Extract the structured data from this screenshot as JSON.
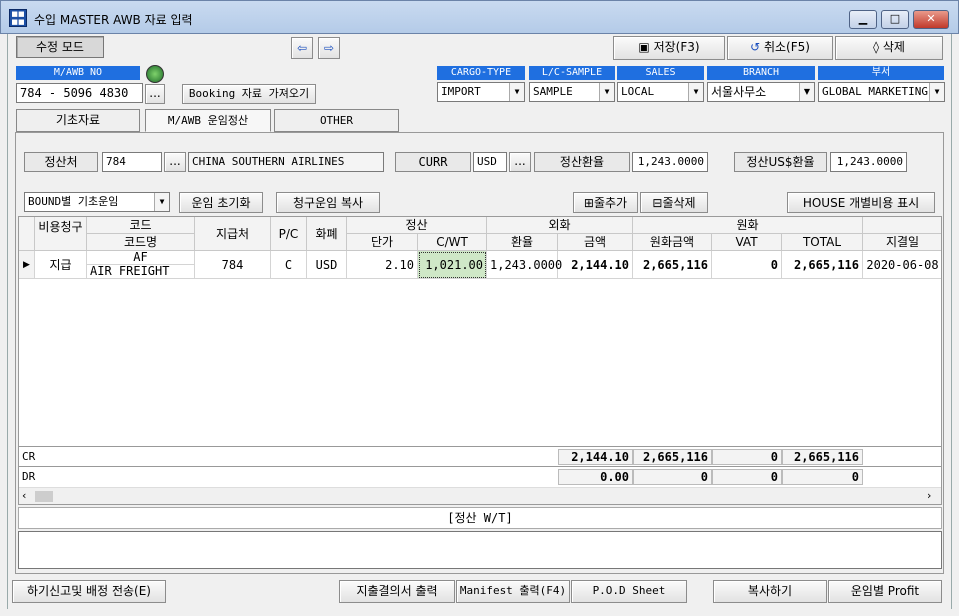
{
  "window": {
    "title": "수입 MASTER AWB 자료 입력",
    "controls": [
      "▁",
      "□",
      "✕"
    ]
  },
  "toolbar": {
    "mode": "수정 모드",
    "prev": "⇦",
    "next": "⇨",
    "save": "저장(F3)",
    "cancel": "취소(F5)",
    "delete": "삭제"
  },
  "header": {
    "mawb_label": "M/AWB NO",
    "mawb_value": "784 - 5096 4830",
    "mawb_lookup": "...",
    "booking_button": "Booking 자료 가져오기",
    "cargo_type": {
      "label": "CARGO-TYPE",
      "value": "IMPORT"
    },
    "lc_sample": {
      "label": "L/C-SAMPLE",
      "value": "SAMPLE"
    },
    "sales": {
      "label": "SALES",
      "value": "LOCAL"
    },
    "branch": {
      "label": "BRANCH",
      "value": "서울사무소"
    },
    "dept": {
      "label": "부서",
      "value": "GLOBAL MARKETING"
    }
  },
  "tabs": [
    {
      "label": "기초자료"
    },
    {
      "label": "M/AWB 운임정산"
    },
    {
      "label": "OTHER"
    }
  ],
  "settle": {
    "party_label": "정산처",
    "party_code": "784",
    "party_lookup": "...",
    "party_name": "CHINA SOUTHERN AIRLINES",
    "curr_label": "CURR",
    "curr_value": "USD",
    "curr_lookup": "...",
    "rate_label": "정산환율",
    "rate_value": "1,243.0000",
    "usd_rate_label": "정산US$환율",
    "usd_rate_value": "1,243.0000"
  },
  "actions": {
    "bound_select": "BOUND별 기초운임",
    "reset": "운임 초기화",
    "copy": "청구운임 복사",
    "add_row": "줄추가",
    "del_row": "줄삭제",
    "house_cost": "HOUSE 개별비용 표시"
  },
  "grid": {
    "headers": {
      "type": "비용청구",
      "code": "코드",
      "code_name": "코드명",
      "payee": "지급처",
      "pc": "P/C",
      "currency": "화폐",
      "settle": "정산",
      "unit_price": "단가",
      "cwt": "C/WT",
      "foreign": "외화",
      "ex_rate": "환율",
      "amount": "금액",
      "krw": "원화",
      "krw_amount": "원화금액",
      "vat": "VAT",
      "total": "TOTAL",
      "pay_date": "지결일"
    },
    "rows": [
      {
        "type": "지급",
        "code": "AF",
        "code_name": "AIR FREIGHT",
        "payee": "784",
        "pc": "C",
        "currency": "USD",
        "unit_price": "2.10",
        "cwt": "1,021.00",
        "ex_rate": "1,243.0000",
        "amount": "2,144.10",
        "krw_amount": "2,665,116",
        "vat": "0",
        "total": "2,665,116",
        "pay_date": "2020-06-08"
      }
    ],
    "cr": {
      "label": "CR",
      "amount": "2,144.10",
      "krw_amount": "2,665,116",
      "vat": "0",
      "total": "2,665,116"
    },
    "dr": {
      "label": "DR",
      "amount": "0.00",
      "krw_amount": "0",
      "vat": "0",
      "total": "0"
    }
  },
  "memo_label": "[정산 W/T]",
  "bottom": {
    "report_send": "하기신고및 배정 전송(E)",
    "expense_print": "지출결의서 출력",
    "manifest": "Manifest 출력(F4)",
    "pod": "P.O.D Sheet",
    "copy": "복사하기",
    "profit": "운임별 Profit"
  }
}
